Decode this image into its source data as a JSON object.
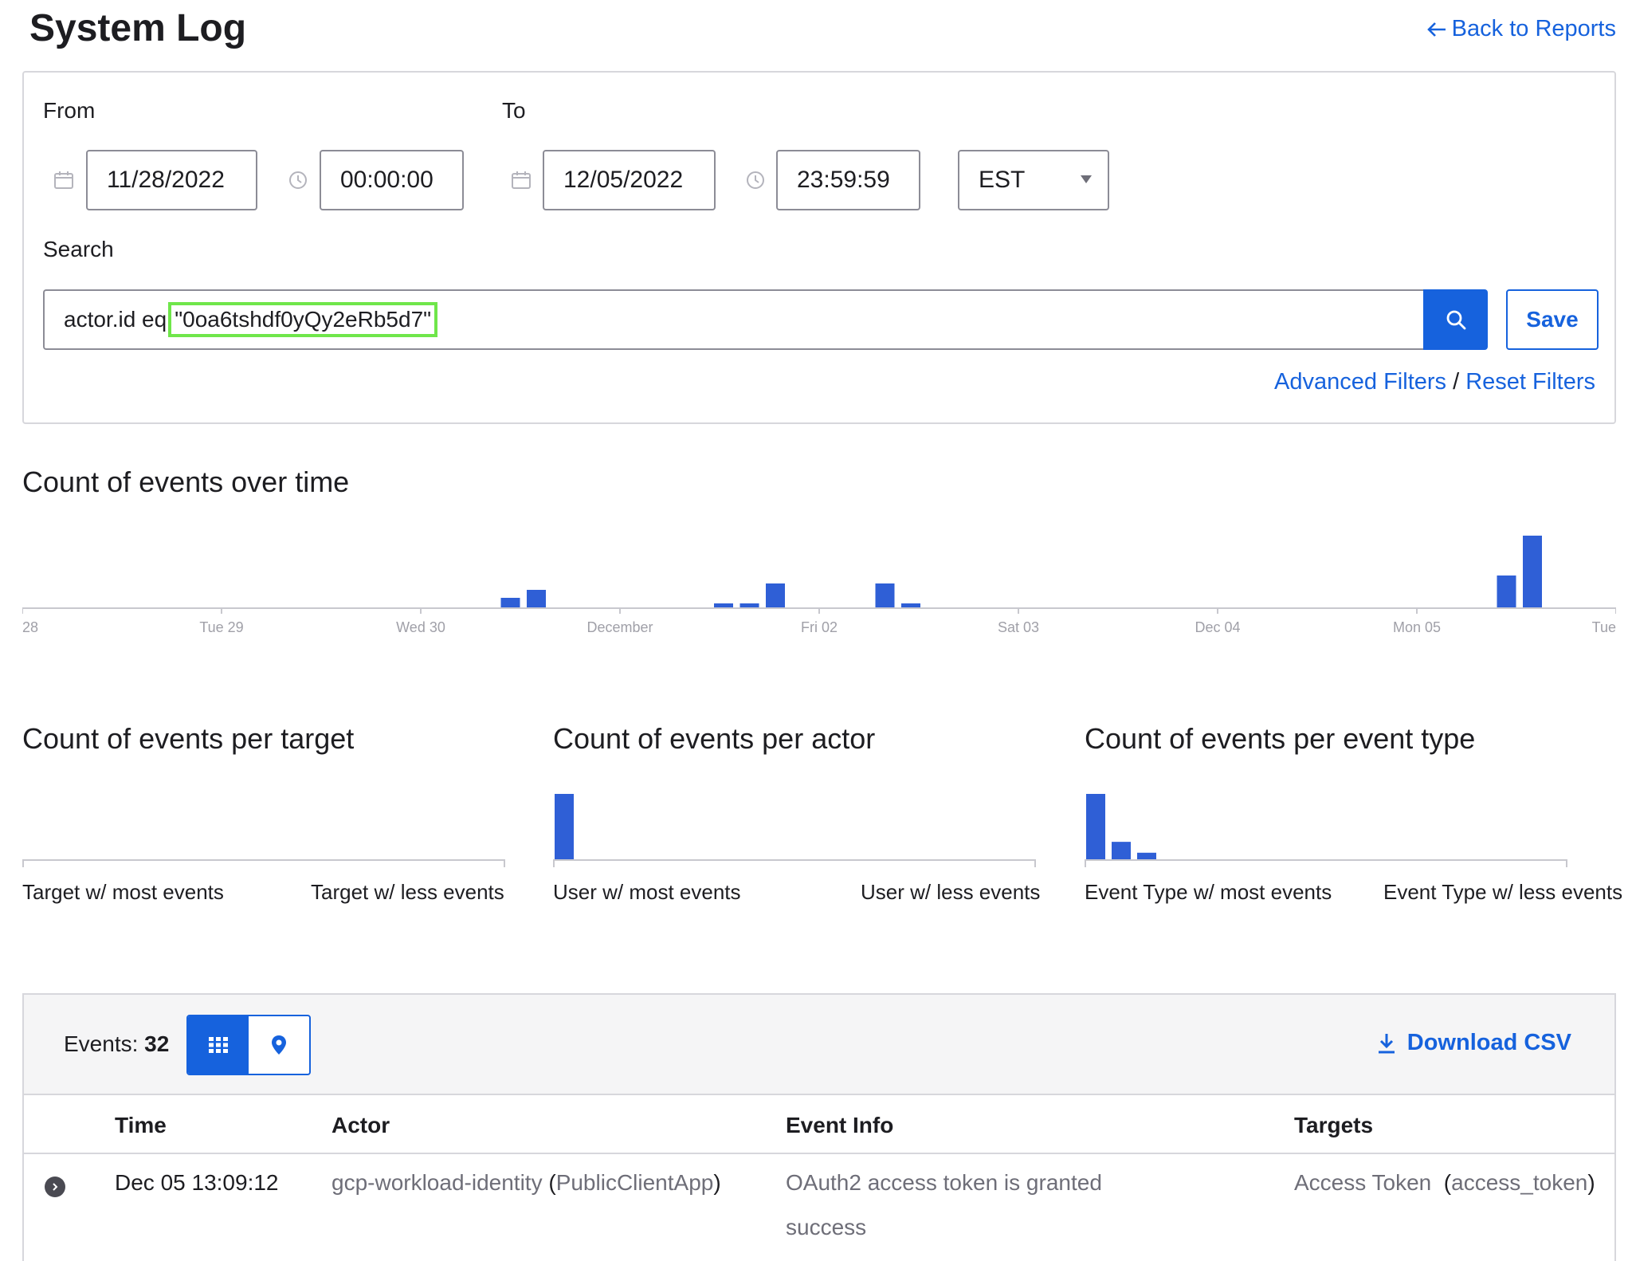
{
  "header": {
    "title": "System Log",
    "back_link": "Back to Reports"
  },
  "filters": {
    "from_label": "From",
    "to_label": "To",
    "from_date": "11/28/2022",
    "from_time": "00:00:00",
    "to_date": "12/05/2022",
    "to_time": "23:59:59",
    "timezone": "EST",
    "search_label": "Search",
    "search_prefix": "actor.id eq",
    "search_value": "\"0oa6tshdf0yQy2eRb5d7\"",
    "save_label": "Save",
    "advanced_filters": "Advanced Filters",
    "separator": "/",
    "reset_filters": "Reset Filters"
  },
  "charts": {
    "over_time_title": "Count of events over time",
    "per_target_title": "Count of events per target",
    "per_actor_title": "Count of events per actor",
    "per_event_type_title": "Count of events per event type",
    "target_most": "Target w/ most events",
    "target_less": "Target w/ less events",
    "actor_most": "User w/ most events",
    "actor_less": "User w/ less events",
    "type_most": "Event Type w/ most events",
    "type_less": "Event Type w/ less events"
  },
  "chart_data": [
    {
      "type": "bar",
      "title": "Count of events over time",
      "x_tick_labels": [
        "28",
        "Tue 29",
        "Wed 30",
        "December",
        "Fri 02",
        "Sat 03",
        "Dec 04",
        "Mon 05",
        "Tue"
      ],
      "x_unit": "days since Nov 28 00:00",
      "x": [
        2.45,
        2.58,
        3.52,
        3.65,
        3.78,
        4.33,
        4.46,
        7.45,
        7.58
      ],
      "values": [
        1.2,
        2.2,
        0.5,
        0.5,
        3.0,
        3.0,
        0.5,
        4.0,
        9.0
      ],
      "color": "#2f5fd6",
      "grid": false
    },
    {
      "type": "bar",
      "title": "Count of events per target",
      "values": [],
      "color": "#2f5fd6"
    },
    {
      "type": "bar",
      "title": "Count of events per actor",
      "values": [
        32
      ],
      "color": "#2f5fd6"
    },
    {
      "type": "bar",
      "title": "Count of events per event type",
      "values": [
        30,
        8,
        3
      ],
      "color": "#2f5fd6"
    }
  ],
  "events": {
    "count_label": "Events:",
    "count": "32",
    "grid_view_icon": "grid-icon",
    "map_view_icon": "map-pin-icon",
    "download_label": "Download CSV",
    "columns": [
      "Time",
      "Actor",
      "Event Info",
      "Targets"
    ],
    "rows": [
      {
        "time": "Dec 05 13:09:12",
        "actor_name": "gcp-workload-identity",
        "actor_type": "PublicClientApp",
        "event": "OAuth2 access token is granted",
        "outcome": "success",
        "target_name": "Access Token",
        "target_type": "access_token"
      }
    ]
  },
  "colors": {
    "accent": "#1662dd",
    "bar": "#2f5fd6",
    "highlight": "#6fe64a"
  }
}
